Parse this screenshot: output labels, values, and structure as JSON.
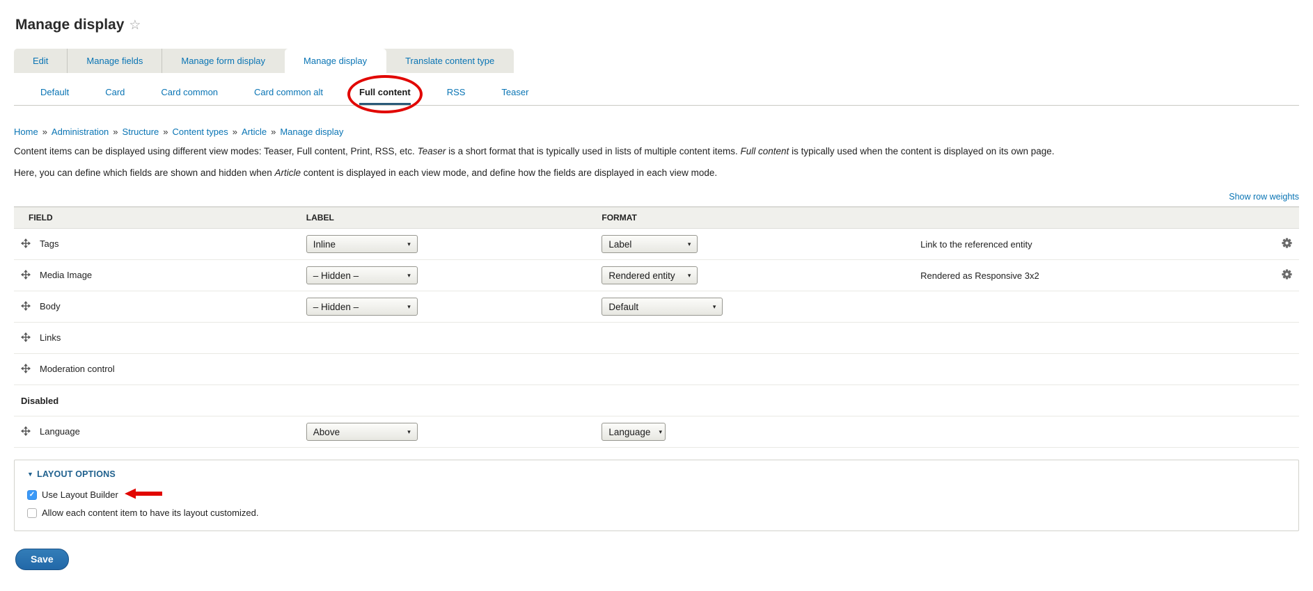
{
  "page": {
    "title": "Manage display"
  },
  "icons": {
    "star": "☆",
    "caret_down": "▼",
    "select_arrow": "▾",
    "breadcrumb_separator": "»",
    "check": "✓"
  },
  "colors": {
    "link_blue": "#0974b4",
    "annotation_red": "#e10600",
    "checkbox_blue": "#3b99f7"
  },
  "primary_tabs": [
    {
      "label": "Edit",
      "active": false
    },
    {
      "label": "Manage fields",
      "active": false
    },
    {
      "label": "Manage form display",
      "active": false
    },
    {
      "label": "Manage display",
      "active": true
    },
    {
      "label": "Translate content type",
      "active": false
    }
  ],
  "view_mode_tabs": [
    {
      "label": "Default",
      "active": false,
      "circled": false
    },
    {
      "label": "Card",
      "active": false,
      "circled": false
    },
    {
      "label": "Card common",
      "active": false,
      "circled": false
    },
    {
      "label": "Card common alt",
      "active": false,
      "circled": false
    },
    {
      "label": "Full content",
      "active": true,
      "circled": true
    },
    {
      "label": "RSS",
      "active": false,
      "circled": false
    },
    {
      "label": "Teaser",
      "active": false,
      "circled": false
    }
  ],
  "breadcrumb": [
    "Home",
    "Administration",
    "Structure",
    "Content types",
    "Article",
    "Manage display"
  ],
  "intro": {
    "p1": [
      {
        "t": "Content items can be displayed using different view modes: Teaser, Full content, Print, RSS, etc. "
      },
      {
        "t": "Teaser",
        "i": true
      },
      {
        "t": " is a short format that is typically used in lists of multiple content items. "
      },
      {
        "t": "Full content",
        "i": true
      },
      {
        "t": " is typically used when the content is displayed on its own page."
      }
    ],
    "p2": [
      {
        "t": "Here, you can define which fields are shown and hidden when "
      },
      {
        "t": "Article",
        "i": true
      },
      {
        "t": " content is displayed in each view mode, and define how the fields are displayed in each view mode."
      }
    ]
  },
  "show_row_weights": "Show row weights",
  "table": {
    "headers": [
      "FIELD",
      "LABEL",
      "FORMAT"
    ],
    "rows": [
      {
        "type": "field",
        "name": "Tags",
        "label": "Inline",
        "label_w": 160,
        "format": "Label",
        "format_w": 138,
        "summary": "Link to the referenced entity",
        "gear": true
      },
      {
        "type": "field",
        "name": "Media Image",
        "label": "– Hidden –",
        "label_w": 160,
        "format": "Rendered entity",
        "format_w": 138,
        "summary": "Rendered as Responsive 3x2",
        "gear": true
      },
      {
        "type": "field",
        "name": "Body",
        "label": "– Hidden –",
        "label_w": 160,
        "format": "Default",
        "format_w": 174,
        "summary": "",
        "gear": false
      },
      {
        "type": "field",
        "name": "Links",
        "label": null,
        "format": null,
        "summary": "",
        "gear": false
      },
      {
        "type": "field",
        "name": "Moderation control",
        "label": null,
        "format": null,
        "summary": "",
        "gear": false
      },
      {
        "type": "section",
        "name": "Disabled"
      },
      {
        "type": "field",
        "name": "Language",
        "label": "Above",
        "label_w": 160,
        "format": "Language",
        "format_w": 92,
        "summary": "",
        "gear": false
      }
    ]
  },
  "layout_options": {
    "legend": "LAYOUT OPTIONS",
    "checkboxes": [
      {
        "label": "Use Layout Builder",
        "checked": true,
        "arrow": true
      },
      {
        "label": "Allow each content item to have its layout customized.",
        "checked": false,
        "arrow": false
      }
    ]
  },
  "save_button": "Save"
}
